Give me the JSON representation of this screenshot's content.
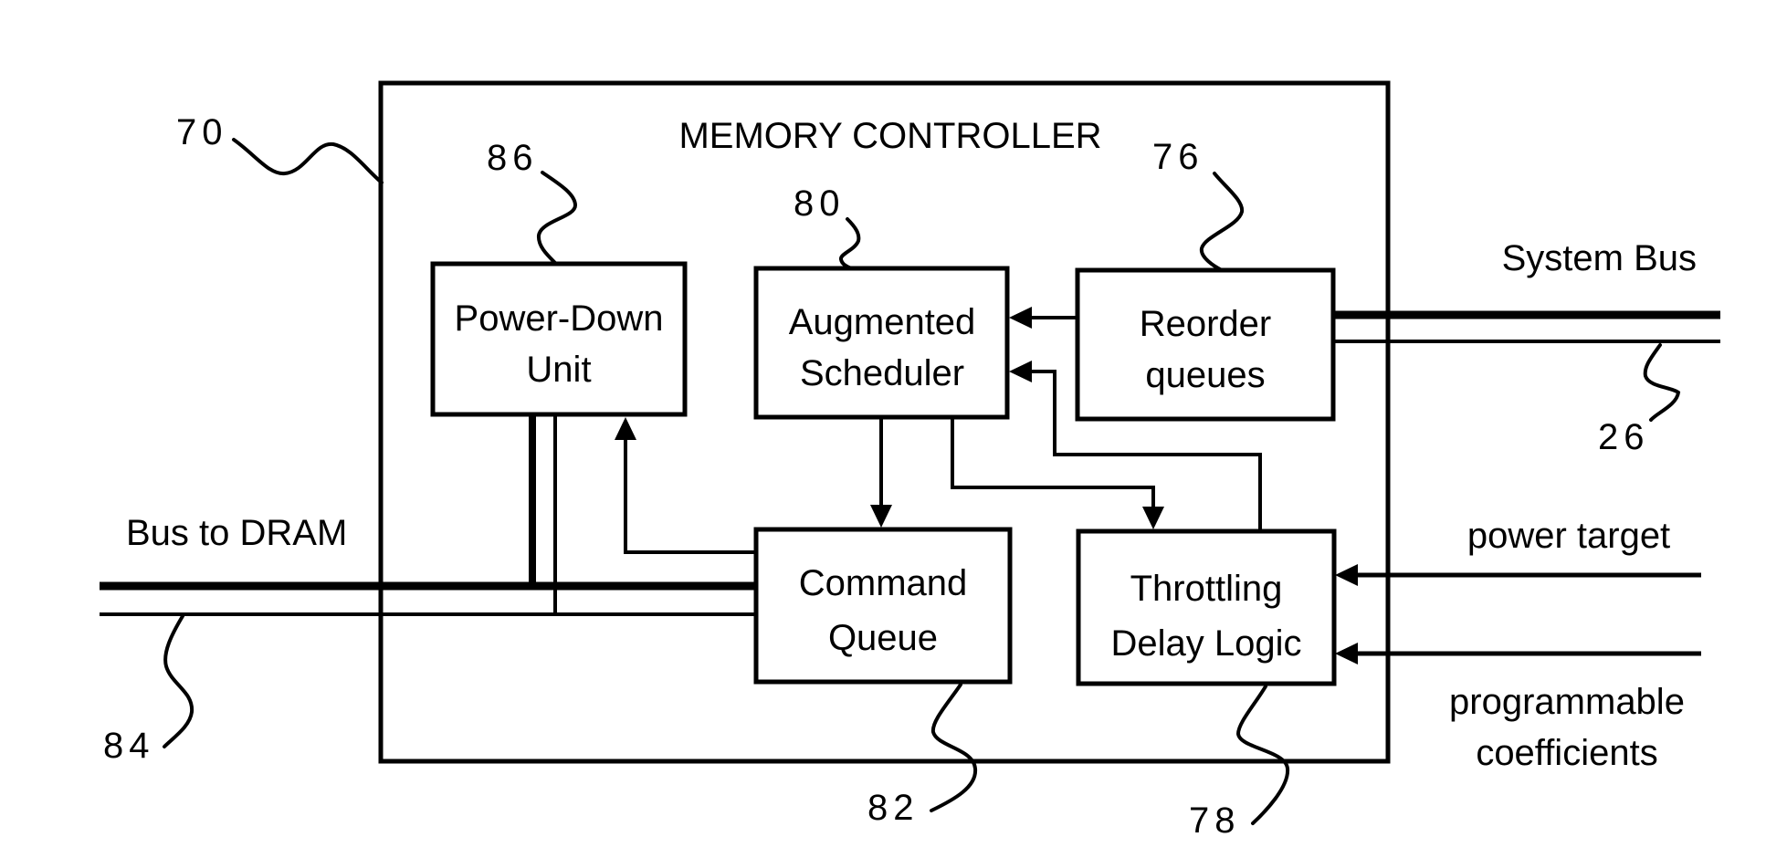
{
  "diagram": {
    "title": "MEMORY CONTROLLER",
    "colors": {
      "line": "#000000",
      "background": "#ffffff"
    },
    "blocks": {
      "power_down": {
        "ref": "86",
        "lines": [
          "Power-Down",
          "Unit"
        ]
      },
      "scheduler": {
        "ref": "80",
        "lines": [
          "Augmented",
          "Scheduler"
        ]
      },
      "reorder": {
        "ref": "76",
        "lines": [
          "Reorder",
          "queues"
        ]
      },
      "command_queue": {
        "ref": "82",
        "lines": [
          "Command",
          "Queue"
        ]
      },
      "throttling": {
        "ref": "78",
        "lines": [
          "Throttling",
          "Delay Logic"
        ]
      }
    },
    "controller_ref": "70",
    "external": {
      "dram_bus": {
        "label": "Bus to DRAM",
        "ref": "84"
      },
      "system_bus": {
        "label": "System Bus",
        "ref": "26"
      },
      "power_target": {
        "label": "power target"
      },
      "coefficients": {
        "lines": [
          "programmable",
          "coefficients"
        ]
      }
    },
    "connections": [
      {
        "from": "reorder",
        "to": "scheduler"
      },
      {
        "from": "throttling",
        "to": "scheduler"
      },
      {
        "from": "scheduler",
        "to": "command_queue"
      },
      {
        "from": "scheduler",
        "to": "throttling"
      },
      {
        "from": "command_queue",
        "to": "power_down"
      },
      {
        "from": "power_target",
        "to": "throttling"
      },
      {
        "from": "coefficients",
        "to": "throttling"
      },
      {
        "from": "power_down",
        "to": "dram_bus"
      },
      {
        "from": "command_queue",
        "to": "dram_bus"
      },
      {
        "from": "reorder",
        "to": "system_bus"
      }
    ]
  }
}
